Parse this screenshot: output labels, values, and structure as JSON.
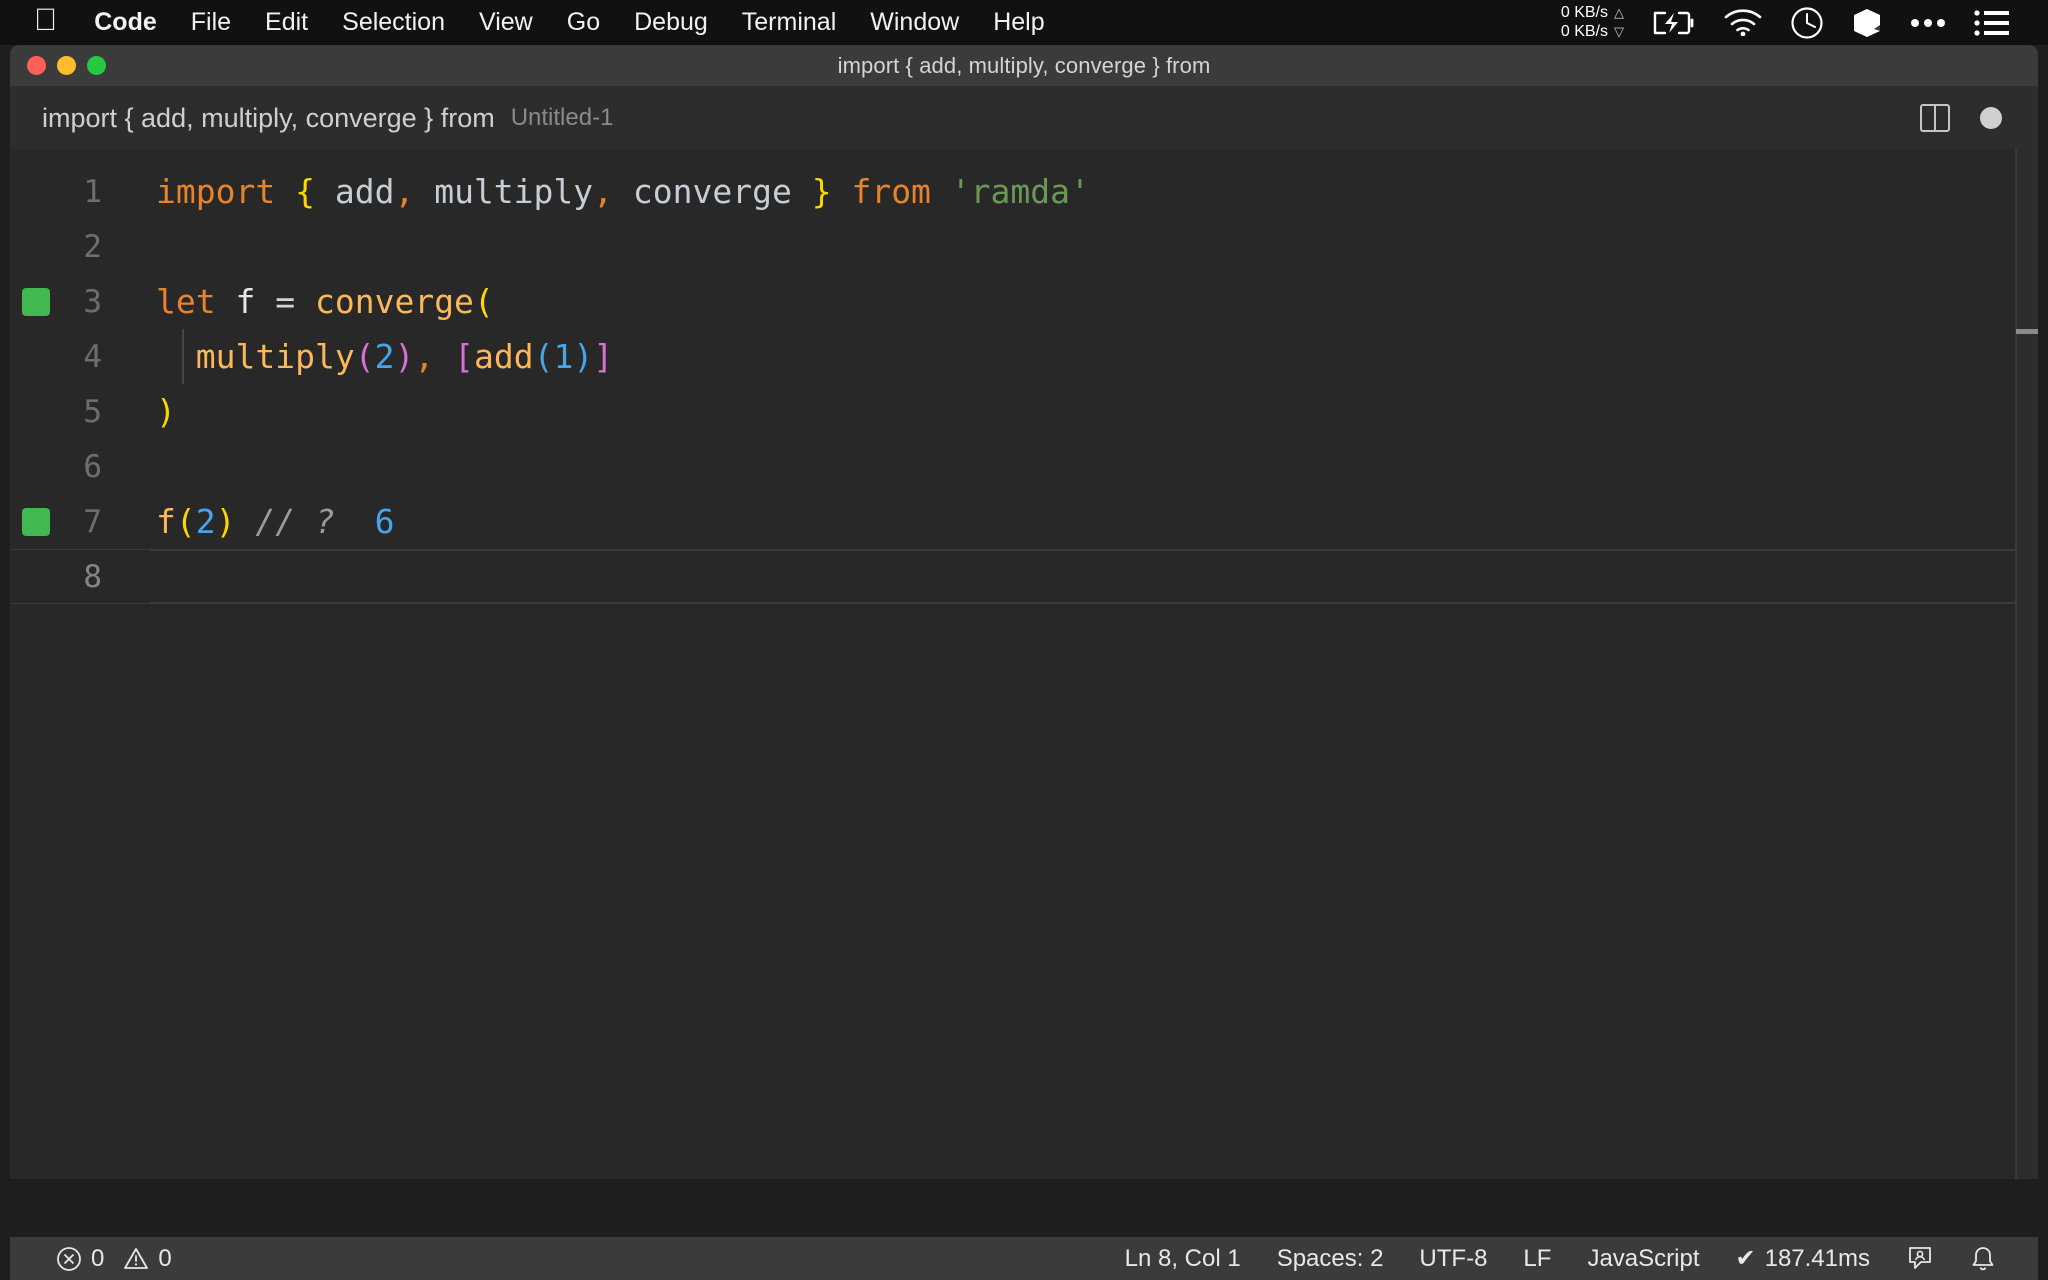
{
  "menubar": {
    "apple_icon": "apple-logo-icon",
    "items": [
      {
        "label": "Code",
        "bold": true
      },
      {
        "label": "File",
        "bold": false
      },
      {
        "label": "Edit",
        "bold": false
      },
      {
        "label": "Selection",
        "bold": false
      },
      {
        "label": "View",
        "bold": false
      },
      {
        "label": "Go",
        "bold": false
      },
      {
        "label": "Debug",
        "bold": false
      },
      {
        "label": "Terminal",
        "bold": false
      },
      {
        "label": "Window",
        "bold": false
      },
      {
        "label": "Help",
        "bold": false
      }
    ],
    "status": {
      "net_up": "0 KB/s",
      "net_down": "0 KB/s",
      "up_arrow": "△",
      "down_arrow": "▽",
      "icons": [
        "battery-charging-icon",
        "wifi-icon",
        "clock-icon",
        "cube-icon",
        "ellipsis-icon",
        "list-menu-icon"
      ]
    }
  },
  "window": {
    "title": "import { add, multiply, converge } from",
    "traffic_lights": [
      "close-button",
      "minimize-button",
      "maximize-button"
    ]
  },
  "breadcrumb": {
    "path": "import { add, multiply, converge } from",
    "file": "Untitled-1",
    "split_editor_icon": "split-editor-icon",
    "dirty_indicator": "unsaved-dot-icon"
  },
  "editor": {
    "language": "JavaScript",
    "lines": [
      {
        "number": "1",
        "marker": false,
        "indent_guide": false,
        "current": false,
        "tokens": [
          {
            "text": "import",
            "cls": "t-kw"
          },
          {
            "text": " ",
            "cls": "t-plain"
          },
          {
            "text": "{",
            "cls": "t-brace"
          },
          {
            "text": " add",
            "cls": "t-plain"
          },
          {
            "text": ",",
            "cls": "t-punct"
          },
          {
            "text": " multiply",
            "cls": "t-plain"
          },
          {
            "text": ",",
            "cls": "t-punct"
          },
          {
            "text": " converge ",
            "cls": "t-plain"
          },
          {
            "text": "}",
            "cls": "t-brace"
          },
          {
            "text": " ",
            "cls": "t-plain"
          },
          {
            "text": "from",
            "cls": "t-kw"
          },
          {
            "text": " ",
            "cls": "t-plain"
          },
          {
            "text": "'ramda'",
            "cls": "t-str"
          }
        ]
      },
      {
        "number": "2",
        "marker": false,
        "indent_guide": false,
        "current": false,
        "tokens": []
      },
      {
        "number": "3",
        "marker": true,
        "indent_guide": false,
        "current": false,
        "tokens": [
          {
            "text": "let",
            "cls": "t-kw"
          },
          {
            "text": " ",
            "cls": "t-plain"
          },
          {
            "text": "f",
            "cls": "t-var"
          },
          {
            "text": " ",
            "cls": "t-plain"
          },
          {
            "text": "=",
            "cls": "t-op"
          },
          {
            "text": " ",
            "cls": "t-plain"
          },
          {
            "text": "converge",
            "cls": "t-fn"
          },
          {
            "text": "(",
            "cls": "t-paren-y"
          }
        ]
      },
      {
        "number": "4",
        "marker": false,
        "indent_guide": true,
        "current": false,
        "tokens": [
          {
            "text": "  ",
            "cls": "t-plain"
          },
          {
            "text": "multiply",
            "cls": "t-fn"
          },
          {
            "text": "(",
            "cls": "t-paren-m"
          },
          {
            "text": "2",
            "cls": "t-num"
          },
          {
            "text": ")",
            "cls": "t-paren-m"
          },
          {
            "text": ",",
            "cls": "t-punct"
          },
          {
            "text": " ",
            "cls": "t-plain"
          },
          {
            "text": "[",
            "cls": "t-paren-m"
          },
          {
            "text": "add",
            "cls": "t-fn"
          },
          {
            "text": "(",
            "cls": "t-paren-b"
          },
          {
            "text": "1",
            "cls": "t-num"
          },
          {
            "text": ")",
            "cls": "t-paren-b"
          },
          {
            "text": "]",
            "cls": "t-paren-m"
          }
        ]
      },
      {
        "number": "5",
        "marker": false,
        "indent_guide": false,
        "current": false,
        "tokens": [
          {
            "text": ")",
            "cls": "t-paren-y"
          }
        ]
      },
      {
        "number": "6",
        "marker": false,
        "indent_guide": false,
        "current": false,
        "tokens": []
      },
      {
        "number": "7",
        "marker": true,
        "indent_guide": false,
        "current": false,
        "tokens": [
          {
            "text": "f",
            "cls": "t-fn"
          },
          {
            "text": "(",
            "cls": "t-paren-y"
          },
          {
            "text": "2",
            "cls": "t-num"
          },
          {
            "text": ")",
            "cls": "t-paren-y"
          },
          {
            "text": " ",
            "cls": "t-plain"
          },
          {
            "text": "// ?",
            "cls": "t-comment"
          },
          {
            "text": "  ",
            "cls": "t-plain"
          },
          {
            "text": "6",
            "cls": "t-num"
          }
        ]
      },
      {
        "number": "8",
        "marker": false,
        "indent_guide": false,
        "current": true,
        "tokens": []
      }
    ]
  },
  "statusbar": {
    "errors": "0",
    "warnings": "0",
    "error_icon": "error-circle-icon",
    "warning_icon": "warning-triangle-icon",
    "position": "Ln 8, Col 1",
    "indentation": "Spaces: 2",
    "encoding": "UTF-8",
    "eol": "LF",
    "language": "JavaScript",
    "run_time": "187.41ms",
    "run_check": "✔",
    "feedback_icon": "feedback-person-icon",
    "bell_icon": "bell-icon"
  },
  "colors": {
    "accent_green": "#3fb950",
    "keyword": "#e8832a",
    "string": "#6a9955",
    "number": "#4aa5e8",
    "function": "#fcb759",
    "bracket_magenta": "#da70d6",
    "bracket_yellow": "#ffd700"
  }
}
